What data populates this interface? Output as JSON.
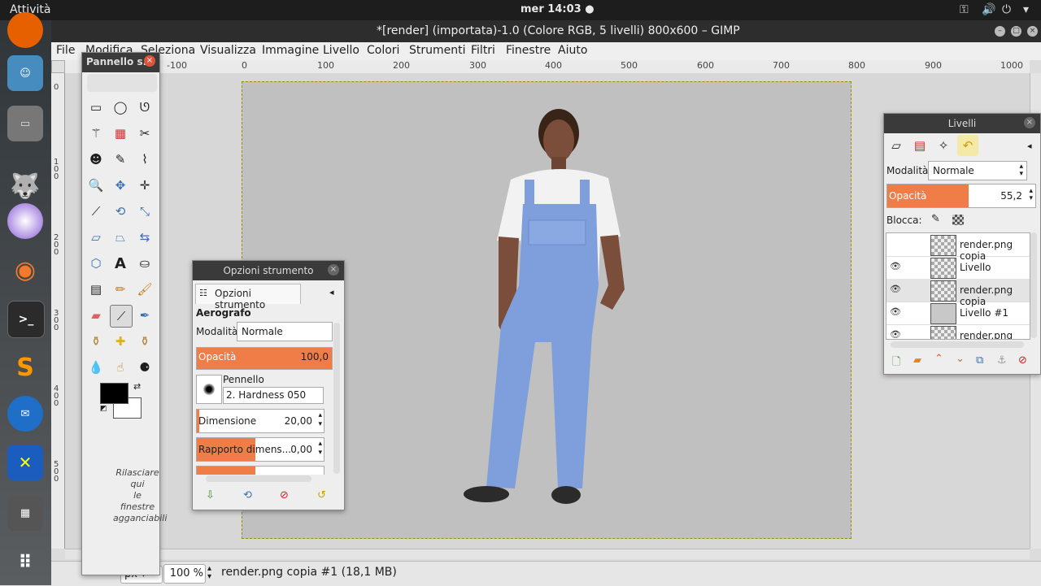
{
  "system": {
    "activities": "Attività",
    "clock": "mer 14:03 ●"
  },
  "window": {
    "title": "*[render] (importata)-1.0 (Colore RGB, 5 livelli) 800x600 – GIMP"
  },
  "menu": [
    "File",
    "Modifica",
    "Seleziona",
    "Visualizza",
    "Immagine",
    "Livello",
    "Colori",
    "Strumenti",
    "Filtri",
    "Finestre",
    "Aiuto"
  ],
  "ruler": {
    "ticks": [
      "-100",
      "0",
      "100",
      "200",
      "300",
      "400",
      "500",
      "600",
      "700",
      "800",
      "900",
      "1000"
    ],
    "vticks": [
      "0",
      "1 0 0",
      "2 0 0",
      "3 0 0",
      "4 0 0",
      "5 0 0"
    ]
  },
  "toolbox": {
    "title": "Pannello s...",
    "dock_hint": [
      "Rilasciare",
      "qui",
      "le",
      "finestre",
      "agganciabili"
    ]
  },
  "tool_options": {
    "window_title": "Opzioni strumento",
    "tab_label": "Opzioni strumento",
    "tool_name": "Aerografo",
    "mode_label": "Modalità:",
    "mode_value": "Normale",
    "opacity_label": "Opacità",
    "opacity_value": "100,0",
    "opacity_fraction": 1.0,
    "brush_label": "Pennello",
    "brush_value": "2. Hardness 050",
    "size_label": "Dimensione",
    "size_value": "20,00",
    "ratio_label": "Rapporto dimens...",
    "ratio_value": "0,00"
  },
  "layers": {
    "title": "Livelli",
    "mode_label": "Modalità:",
    "mode_value": "Normale",
    "opacity_label": "Opacità",
    "opacity_value": "55,2",
    "opacity_fraction": 0.552,
    "lock_label": "Blocca:",
    "items": [
      {
        "name": "render.png copia"
      },
      {
        "name": "Livello"
      },
      {
        "name": "render.png copia"
      },
      {
        "name": "Livello #1"
      },
      {
        "name": "render.png"
      }
    ]
  },
  "status": {
    "unit": "px",
    "zoom": "100 %",
    "info": "render.png copia #1 (18,1 MB)"
  },
  "colors": {
    "accent": "#f07d47",
    "canvas": "#c0c0c0"
  }
}
